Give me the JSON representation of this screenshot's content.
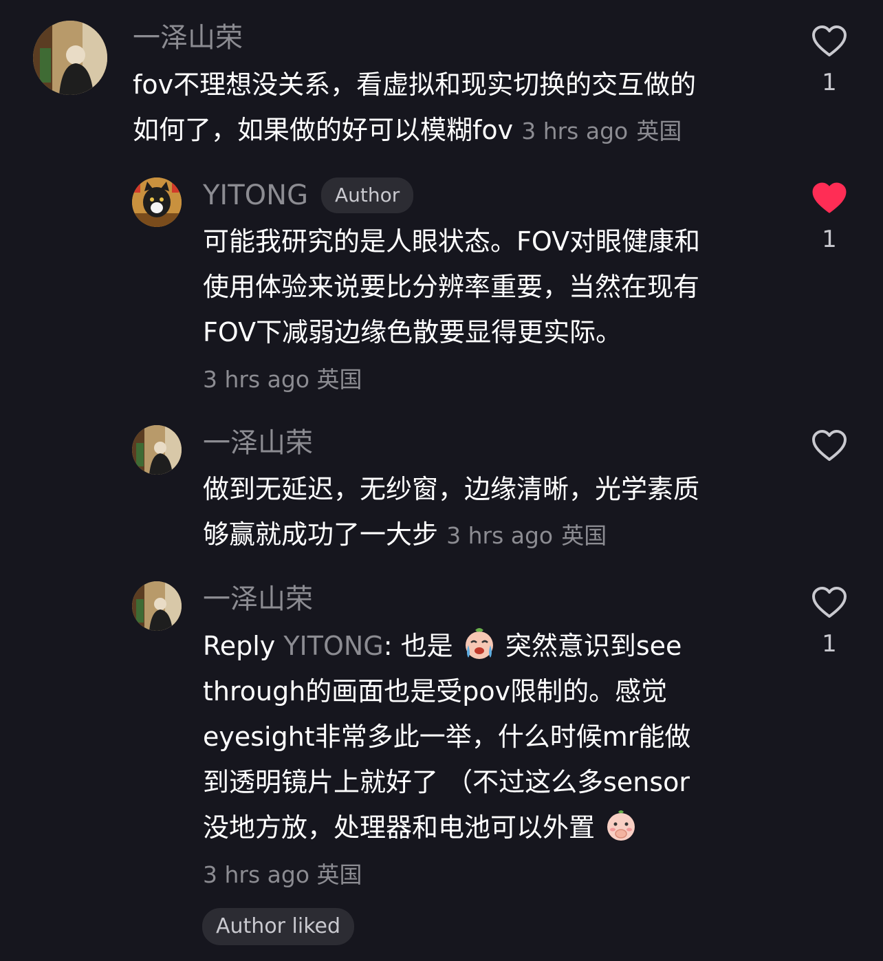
{
  "comments": [
    {
      "username": "一泽山荣",
      "text": "fov不理想没关系，看虚拟和现实切换的交互做的如何了，如果做的好可以模糊fov",
      "line1": "fov不理想没关系，看虚拟和现实切换的交互做的",
      "line2": "如何了，如果做的好可以模糊fov",
      "time": "3 hrs ago",
      "location": "英国",
      "like_count": "1",
      "liked": false
    },
    {
      "username": "YITONG",
      "badge": "Author",
      "line1": "可能我研究的是人眼状态。FOV对眼健康和",
      "line2": "使用体验来说要比分辨率重要，当然在现有",
      "line3": "FOV下减弱边缘色散要显得更实际。",
      "time": "3 hrs ago",
      "location": "英国",
      "like_count": "1",
      "liked": true
    },
    {
      "username": "一泽山荣",
      "line1": "做到无延迟，无纱窗，边缘清晰，光学素质",
      "line2": "够赢就成功了一大步",
      "time": "3 hrs ago",
      "location": "英国",
      "like_count": "",
      "liked": false
    },
    {
      "username": "一泽山荣",
      "reply_prefix": "Reply",
      "reply_to": "YITONG",
      "line1_a": ": 也是",
      "line1_b": "突然意识到see",
      "line2": "through的画面也是受pov限制的。感觉",
      "line3": "eyesight非常多此一举，什么时候mr能做",
      "line4": "到透明镜片上就好了 （不过这么多sensor",
      "line5": "没地方放，处理器和电池可以外置",
      "time": "3 hrs ago",
      "location": "英国",
      "like_count": "1",
      "liked": false,
      "author_liked": "Author liked"
    }
  ],
  "colors": {
    "background": "#16161e",
    "muted_text": "#8c8c92",
    "heart_red": "#ff2d55",
    "pill_bg": "#2c2c33"
  },
  "icons": {
    "like": "heart-outline-icon",
    "liked": "heart-filled-icon",
    "emoji1": "crying-face-emoji",
    "emoji2": "shy-face-emoji"
  }
}
